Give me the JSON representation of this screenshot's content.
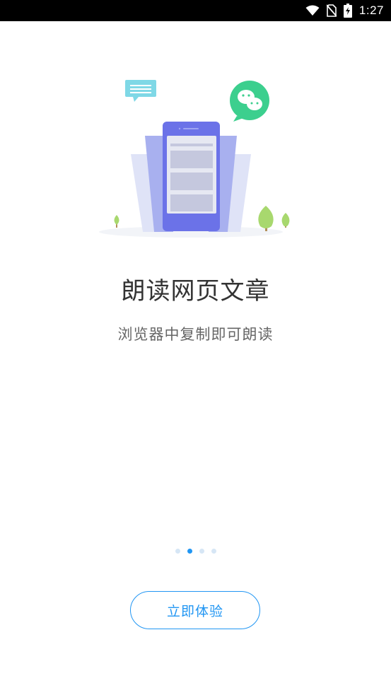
{
  "status_bar": {
    "time": "1:27",
    "icons": [
      "wifi-icon",
      "no-sim-icon",
      "battery-charging-icon"
    ]
  },
  "onboarding": {
    "title": "朗读网页文章",
    "subtitle": "浏览器中复制即可朗读",
    "page_indicator": {
      "total": 4,
      "active_index": 1
    },
    "cta_label": "立即体验"
  },
  "colors": {
    "accent": "#2196f3",
    "phone": "#6b72e8",
    "chat_bubble_green": "#3ccf8e",
    "message_bubble_cyan": "#7fd8e6",
    "tree_green": "#a8d86e"
  }
}
